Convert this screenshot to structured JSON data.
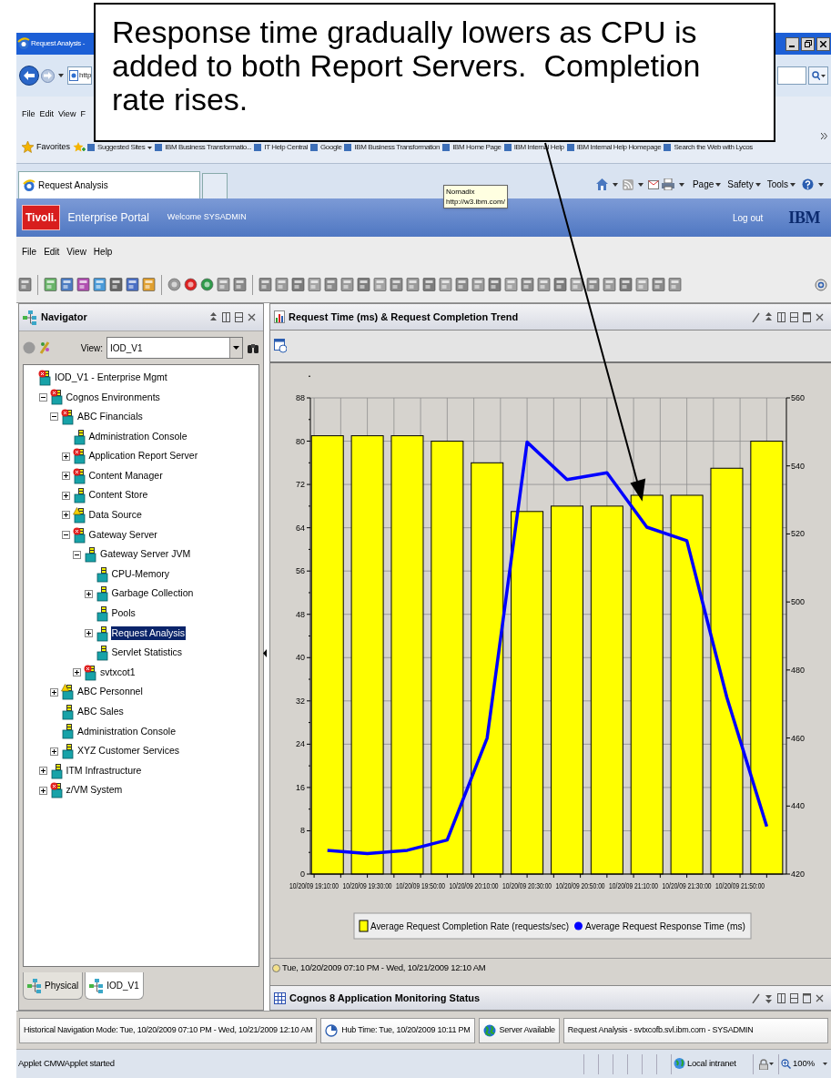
{
  "browser": {
    "title": "Request Analysis -",
    "address": "http",
    "menu": [
      "File",
      "Edit",
      "View",
      "F"
    ],
    "favorites_label": "Favorites",
    "bookmarks": [
      "Suggested Sites",
      "IBM Business Transformatio...",
      "IT Help Central",
      "Google",
      "IBM Business Transformation",
      "IBM Home Page",
      "IBM Internal Help",
      "IBM Internal Help Homepage",
      "Search the Web with Lycos"
    ],
    "tab": {
      "label": "Request Analysis",
      "selected": true
    },
    "command_bar": [
      "Page",
      "Safety",
      "Tools"
    ],
    "tooltip": [
      "Nomadix",
      "http://w3.ibm.com/"
    ]
  },
  "callout": {
    "text": "Response time gradually lowers as CPU is added to both Report Servers.  Completion rate rises."
  },
  "portal": {
    "logo": "Tivoli.",
    "product": "Enterprise Portal",
    "welcome": "Welcome SYSADMIN",
    "logout": "Log out",
    "brand": "IBM",
    "menu": [
      "File",
      "Edit",
      "View",
      "Help"
    ]
  },
  "navigator": {
    "title": "Navigator",
    "view_label": "View:",
    "view_value": "IOD_V1",
    "tree": [
      {
        "label": "IOD_V1 - Enterprise Mgmt",
        "kind": "critical",
        "selected": false,
        "children": [
          {
            "label": "Cognos Environments",
            "kind": "critical",
            "expanded": true,
            "selected": false,
            "children": [
              {
                "label": "ABC Financials",
                "kind": "critical",
                "expanded": true,
                "selected": false,
                "children": [
                  {
                    "label": "Administration Console",
                    "kind": "normal",
                    "selected": false
                  },
                  {
                    "label": "Application Report Server",
                    "kind": "critical",
                    "expanded": false,
                    "selected": false
                  },
                  {
                    "label": "Content Manager",
                    "kind": "critical",
                    "expanded": false,
                    "selected": false
                  },
                  {
                    "label": "Content Store",
                    "kind": "normal",
                    "expanded": false,
                    "selected": false
                  },
                  {
                    "label": "Data Source",
                    "kind": "warning",
                    "expanded": false,
                    "selected": false
                  },
                  {
                    "label": "Gateway Server",
                    "kind": "critical",
                    "expanded": true,
                    "selected": false,
                    "children": [
                      {
                        "label": "Gateway Server JVM",
                        "kind": "normal",
                        "expanded": true,
                        "selected": false,
                        "children": [
                          {
                            "label": "CPU-Memory",
                            "kind": "normal",
                            "selected": false
                          },
                          {
                            "label": "Garbage Collection",
                            "kind": "normal",
                            "expanded": false,
                            "selected": false
                          },
                          {
                            "label": "Pools",
                            "kind": "normal",
                            "selected": false
                          },
                          {
                            "label": "Request Analysis",
                            "kind": "normal",
                            "expanded": false,
                            "selected": true
                          },
                          {
                            "label": "Servlet Statistics",
                            "kind": "normal",
                            "selected": false
                          }
                        ]
                      },
                      {
                        "label": "svtxcot1",
                        "kind": "critical",
                        "expanded": false,
                        "selected": false
                      }
                    ]
                  }
                ]
              },
              {
                "label": "ABC Personnel",
                "kind": "warning",
                "expanded": false,
                "selected": false
              },
              {
                "label": "ABC Sales",
                "kind": "normal",
                "selected": false
              },
              {
                "label": "Administration Console",
                "kind": "normal",
                "selected": false
              },
              {
                "label": "XYZ Customer Services",
                "kind": "normal",
                "expanded": false,
                "selected": false
              }
            ]
          },
          {
            "label": "ITM Infrastructure",
            "kind": "normal",
            "expanded": false,
            "selected": false
          },
          {
            "label": "z/VM System",
            "kind": "critical",
            "expanded": false,
            "selected": false
          }
        ]
      }
    ],
    "tabs": [
      {
        "label": "Physical",
        "selected": false
      },
      {
        "label": "IOD_V1",
        "selected": true
      }
    ]
  },
  "chart_panel": {
    "title": "Request Time (ms) & Request Completion Trend",
    "chart_data": {
      "type": "bar",
      "grid": true,
      "legend": "bottom",
      "ylim": [
        0,
        88
      ],
      "yticks": [
        0,
        8,
        16,
        24,
        32,
        40,
        48,
        56,
        64,
        72,
        80,
        88
      ],
      "y2lim": [
        420,
        560
      ],
      "y2ticks": [
        420,
        440,
        460,
        480,
        500,
        520,
        540,
        560
      ],
      "series": [
        {
          "name": "Average Request Completion Rate (requests/sec)",
          "color": "#ffff00",
          "type": "bar",
          "values": [
            81,
            81,
            81,
            80,
            76,
            67,
            68,
            68,
            70,
            70,
            75,
            80
          ]
        },
        {
          "name": "Average Request Response Time (ms)",
          "color": "#0000ff",
          "type": "line",
          "axis": "y2",
          "values": [
            427,
            426,
            427,
            430,
            460,
            547,
            536,
            538,
            522,
            518,
            472,
            434
          ]
        }
      ]
    },
    "x_axis_labels": [
      "10/20/09 19:10:00",
      "10/20/09 19:30:00",
      "10/20/09 19:50:00",
      "10/20/09 20:10:00",
      "10/20/09 20:30:00",
      "10/20/09 20:50:00",
      "10/20/09 21:10:00",
      "10/20/09 21:30:00",
      "10/20/09 21:50:00"
    ],
    "time_range": "Tue, 10/20/2009 07:10 PM - Wed, 10/21/2009 12:10 AM"
  },
  "status_panel": {
    "title": "Cognos 8 Application Monitoring Status"
  },
  "status_bar": [
    "Historical Navigation Mode: Tue, 10/20/2009 07:10 PM - Wed, 10/21/2009 12:10 AM",
    "Hub Time: Tue, 10/20/2009 10:11 PM",
    "Server Available",
    "Request Analysis - svtxcofb.svl.ibm.com - SYSADMIN"
  ],
  "browser_status": {
    "text": "Applet CMWApplet started",
    "zone": "Local intranet",
    "zoom": "100%"
  }
}
